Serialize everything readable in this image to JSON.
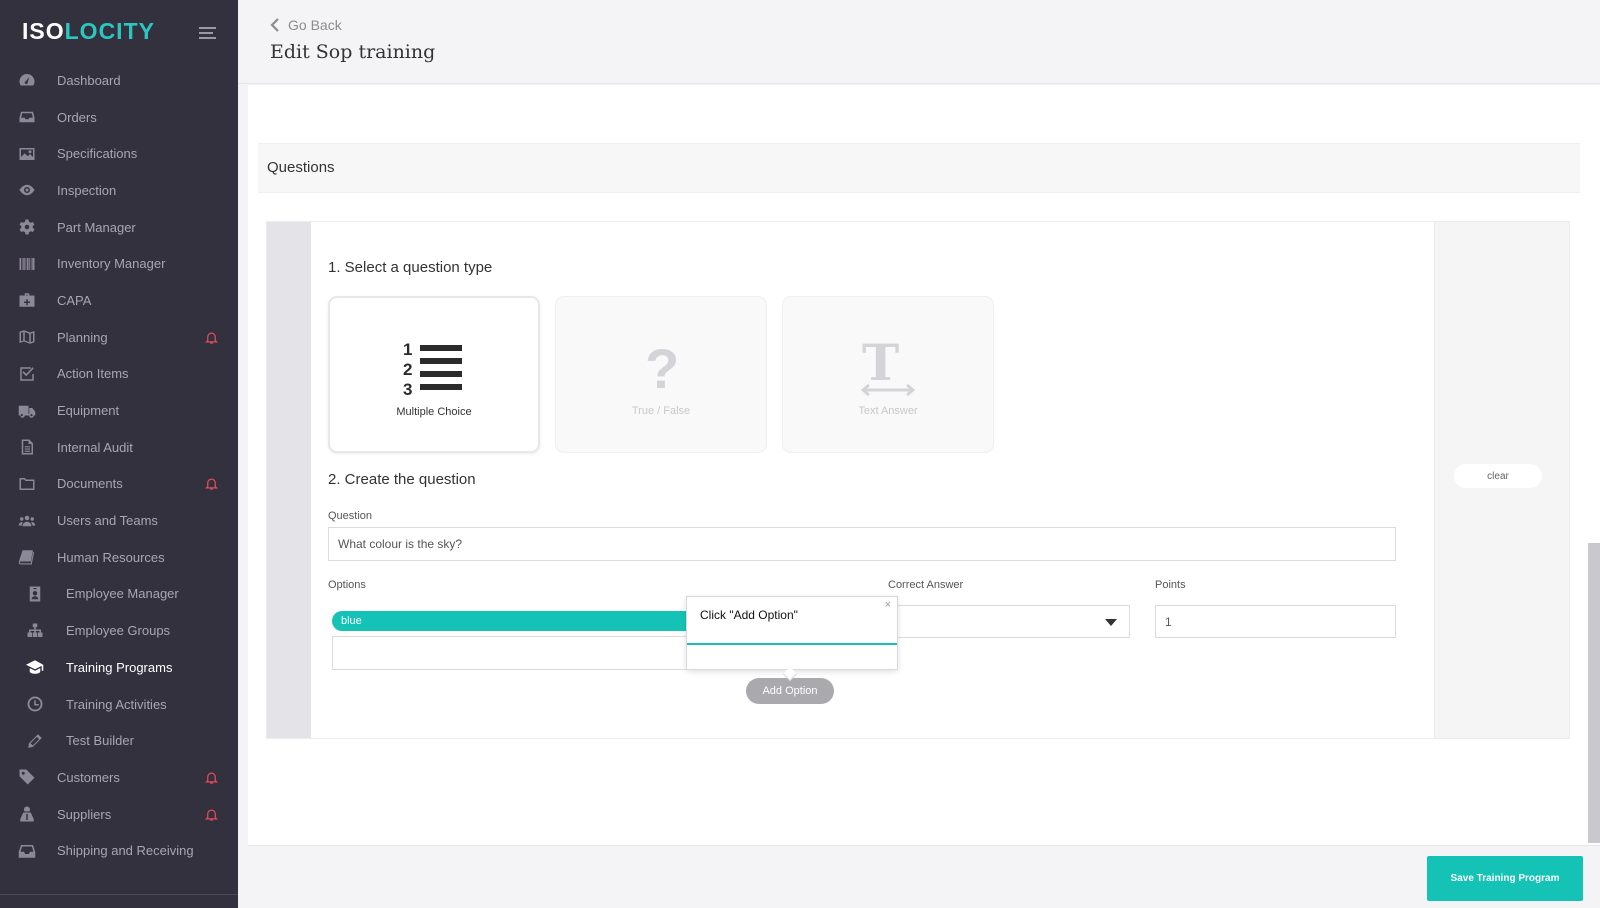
{
  "sidebar": {
    "logo_left": "ISO",
    "logo_right": "LOCITY",
    "items": [
      {
        "label": "Dashboard",
        "icon": "dashboard-icon"
      },
      {
        "label": "Orders",
        "icon": "inbox-icon"
      },
      {
        "label": "Specifications",
        "icon": "image-icon"
      },
      {
        "label": "Inspection",
        "icon": "eye-icon"
      },
      {
        "label": "Part Manager",
        "icon": "gear-icon"
      },
      {
        "label": "Inventory Manager",
        "icon": "barcode-icon"
      },
      {
        "label": "CAPA",
        "icon": "medkit-icon"
      },
      {
        "label": "Planning",
        "icon": "map-icon",
        "bell": true
      },
      {
        "label": "Action Items",
        "icon": "checkbox-icon"
      },
      {
        "label": "Equipment",
        "icon": "truck-icon"
      },
      {
        "label": "Internal Audit",
        "icon": "file-icon"
      },
      {
        "label": "Documents",
        "icon": "folder-icon",
        "bell": true
      },
      {
        "label": "Users and Teams",
        "icon": "users-icon"
      },
      {
        "label": "Human Resources",
        "icon": "book-icon"
      },
      {
        "label": "Employee Manager",
        "icon": "id-badge-icon",
        "sub": true
      },
      {
        "label": "Employee Groups",
        "icon": "sitemap-icon",
        "sub": true
      },
      {
        "label": "Training Programs",
        "icon": "graduation-cap-icon",
        "sub": true,
        "active": true
      },
      {
        "label": "Training Activities",
        "icon": "clock-icon",
        "sub": true
      },
      {
        "label": "Test Builder",
        "icon": "pencil-icon",
        "sub": true
      },
      {
        "label": "Customers",
        "icon": "tag-icon",
        "bell": true
      },
      {
        "label": "Suppliers",
        "icon": "supplier-icon",
        "bell": true
      },
      {
        "label": "Shipping and Receiving",
        "icon": "inbox-tray-icon"
      }
    ]
  },
  "header": {
    "go_back": "Go Back",
    "title": "Edit Sop training"
  },
  "section": {
    "title": "Questions"
  },
  "question_editor": {
    "step1": "1. Select a question type",
    "types": [
      {
        "label": "Multiple Choice",
        "icon": "list-numbered-icon",
        "selected": true
      },
      {
        "label": "True / False",
        "icon": "question-mark-icon",
        "selected": false
      },
      {
        "label": "Text Answer",
        "icon": "text-type-icon",
        "selected": false
      }
    ],
    "step2": "2. Create the question",
    "question_label": "Question",
    "question_value": "What colour is the sky?",
    "options_label": "Options",
    "option_tag": "blue",
    "correct_answer_label": "Correct Answer",
    "points_label": "Points",
    "points_value": "1",
    "add_option": "Add Option",
    "clear": "clear"
  },
  "tooltip": {
    "text": "Click \"Add Option\"",
    "close": "×"
  },
  "footer": {
    "save": "Save Training Program"
  },
  "colors": {
    "sidebar_bg": "#34313f",
    "accent": "#14c3b5",
    "bell": "#e34b5a"
  }
}
